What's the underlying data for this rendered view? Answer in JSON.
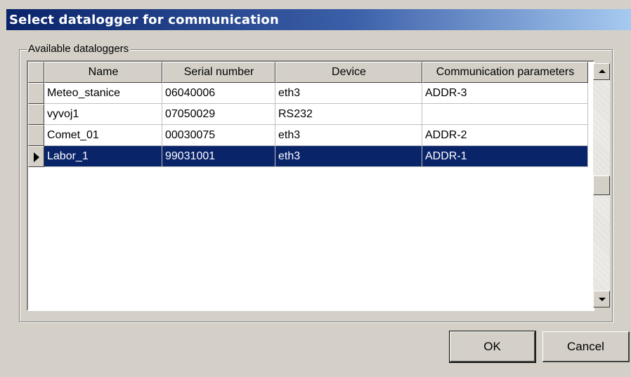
{
  "window": {
    "title": "Select datalogger for communication"
  },
  "group": {
    "label": "Available dataloggers"
  },
  "table": {
    "columns": [
      "Name",
      "Serial number",
      "Device",
      "Communication parameters"
    ],
    "rows": [
      {
        "name": "Meteo_stanice",
        "serial": "06040006",
        "device": "eth3",
        "params": "ADDR-3",
        "selected": false
      },
      {
        "name": "vyvoj1",
        "serial": "07050029",
        "device": "RS232",
        "params": "",
        "selected": false
      },
      {
        "name": "Comet_01",
        "serial": "00030075",
        "device": "eth3",
        "params": "ADDR-2",
        "selected": false
      },
      {
        "name": "Labor_1",
        "serial": "99031001",
        "device": "eth3",
        "params": "ADDR-1",
        "selected": true
      }
    ]
  },
  "buttons": {
    "ok": "OK",
    "cancel": "Cancel"
  },
  "colors": {
    "titlebar_start": "#0a246a",
    "titlebar_end": "#a6caf0",
    "selection": "#0a246a",
    "face": "#d4d0c8"
  }
}
